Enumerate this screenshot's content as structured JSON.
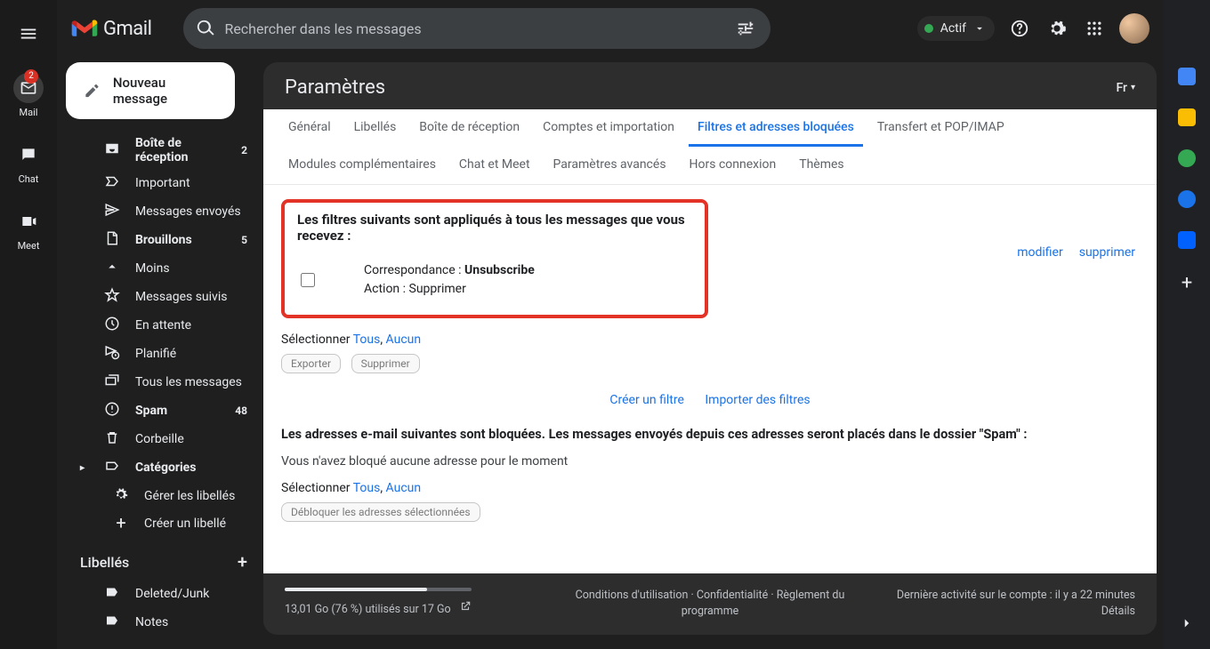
{
  "header": {
    "app_name": "Gmail",
    "search_placeholder": "Rechercher dans les messages",
    "status_label": "Actif",
    "locale_code": "Fr"
  },
  "rail": {
    "mail": "Mail",
    "mail_badge": "2",
    "chat": "Chat",
    "meet": "Meet"
  },
  "compose_label": "Nouveau message",
  "sidebar": {
    "items": [
      {
        "label": "Boîte de réception",
        "count": "2",
        "bold": true,
        "icon": "inbox"
      },
      {
        "label": "Important",
        "icon": "label-important"
      },
      {
        "label": "Messages envoyés",
        "icon": "send"
      },
      {
        "label": "Brouillons",
        "count": "5",
        "bold": true,
        "icon": "draft"
      },
      {
        "label": "Moins",
        "icon": "expand-less"
      },
      {
        "label": "Messages suivis",
        "icon": "star"
      },
      {
        "label": "En attente",
        "icon": "schedule"
      },
      {
        "label": "Planifié",
        "icon": "schedule-send"
      },
      {
        "label": "Tous les messages",
        "icon": "all-mail"
      },
      {
        "label": "Spam",
        "count": "48",
        "bold": true,
        "icon": "spam"
      },
      {
        "label": "Corbeille",
        "icon": "delete"
      },
      {
        "label": "Catégories",
        "bold": true,
        "icon": "categories",
        "caret": true
      },
      {
        "label": "Gérer les libellés",
        "icon": "settings",
        "indent": true
      },
      {
        "label": "Créer un libellé",
        "icon": "add",
        "indent": true
      }
    ],
    "labels_header": "Libellés",
    "labels": [
      {
        "label": "Deleted/Junk"
      },
      {
        "label": "Notes"
      }
    ]
  },
  "settings": {
    "title": "Paramètres",
    "tabs_row1": [
      "Général",
      "Libellés",
      "Boîte de réception",
      "Comptes et importation",
      "Filtres et adresses bloquées",
      "Transfert et POP/IMAP",
      "Modules complémentaires"
    ],
    "tabs_row2": [
      "Chat et Meet",
      "Paramètres avancés",
      "Hors connexion",
      "Thèmes"
    ],
    "active_tab": "Filtres et adresses bloquées",
    "filters_applied_heading": "Les filtres suivants sont appliqués à tous les messages que vous recevez :",
    "match_prefix": "Correspondance : ",
    "match_value": "Unsubscribe",
    "action_prefix": "Action : ",
    "action_value": "Supprimer",
    "modify": "modifier",
    "delete": "supprimer",
    "select_label": "Sélectionner ",
    "all": "Tous",
    "none": "Aucun",
    "export": "Exporter",
    "delete_btn": "Supprimer",
    "create_filter": "Créer un filtre",
    "import_filters": "Importer des filtres",
    "blocked_heading": "Les adresses e-mail suivantes sont bloquées. Les messages envoyés depuis ces adresses seront placés dans le dossier \"Spam\" :",
    "no_blocked": "Vous n'avez bloqué aucune adresse pour le moment",
    "unblock_selected": "Débloquer les adresses sélectionnées"
  },
  "footer": {
    "storage_text": "13,01 Go (76 %) utilisés sur 17 Go",
    "storage_percent": 76,
    "terms": "Conditions d'utilisation",
    "privacy": "Confidentialité",
    "program": "Règlement du programme",
    "activity": "Dernière activité sur le compte : il y a 22 minutes",
    "details": "Détails"
  }
}
